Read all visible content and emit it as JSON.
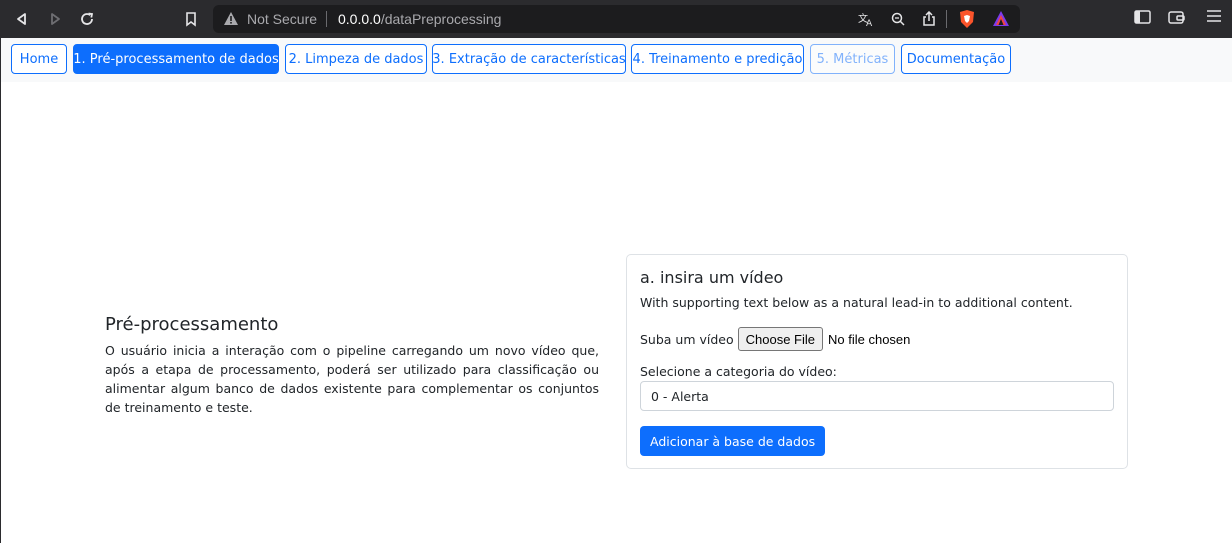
{
  "browser": {
    "not_secure": "Not Secure",
    "url_host": "0.0.0.0",
    "url_path": "/dataPreprocessing",
    "colors": {
      "chrome_bg": "#2b2b2e",
      "urlbar_bg": "#1c1c1e",
      "brave_orange": "#fb542b"
    }
  },
  "nav": {
    "items": [
      {
        "label": "Home",
        "state": "default"
      },
      {
        "label": "1. Pré-processamento de dados",
        "state": "active"
      },
      {
        "label": "2. Limpeza de dados",
        "state": "default"
      },
      {
        "label": "3. Extração de características",
        "state": "default"
      },
      {
        "label": "4. Treinamento e predição",
        "state": "default"
      },
      {
        "label": "5. Métricas",
        "state": "disabled"
      },
      {
        "label": "Documentação",
        "state": "default"
      }
    ],
    "accent": "#0d6efd"
  },
  "intro": {
    "title": "Pré-processamento",
    "body": "O usuário inicia a interação com o pipeline carregando um novo vídeo que, após a etapa de processamento, poderá ser utilizado para classificação ou alimentar algum banco de dados existente para complementar os conjuntos de treinamento e teste."
  },
  "card": {
    "title": "a. insira um vídeo",
    "text": "With supporting text below as a natural lead-in to additional content.",
    "upload_label": "Suba um vídeo",
    "file_button": "Choose File",
    "file_status": "No file chosen",
    "select_label": "Selecione a categoria do vídeo:",
    "select_value": "0 - Alerta",
    "submit_label": "Adicionar à base de dados"
  }
}
